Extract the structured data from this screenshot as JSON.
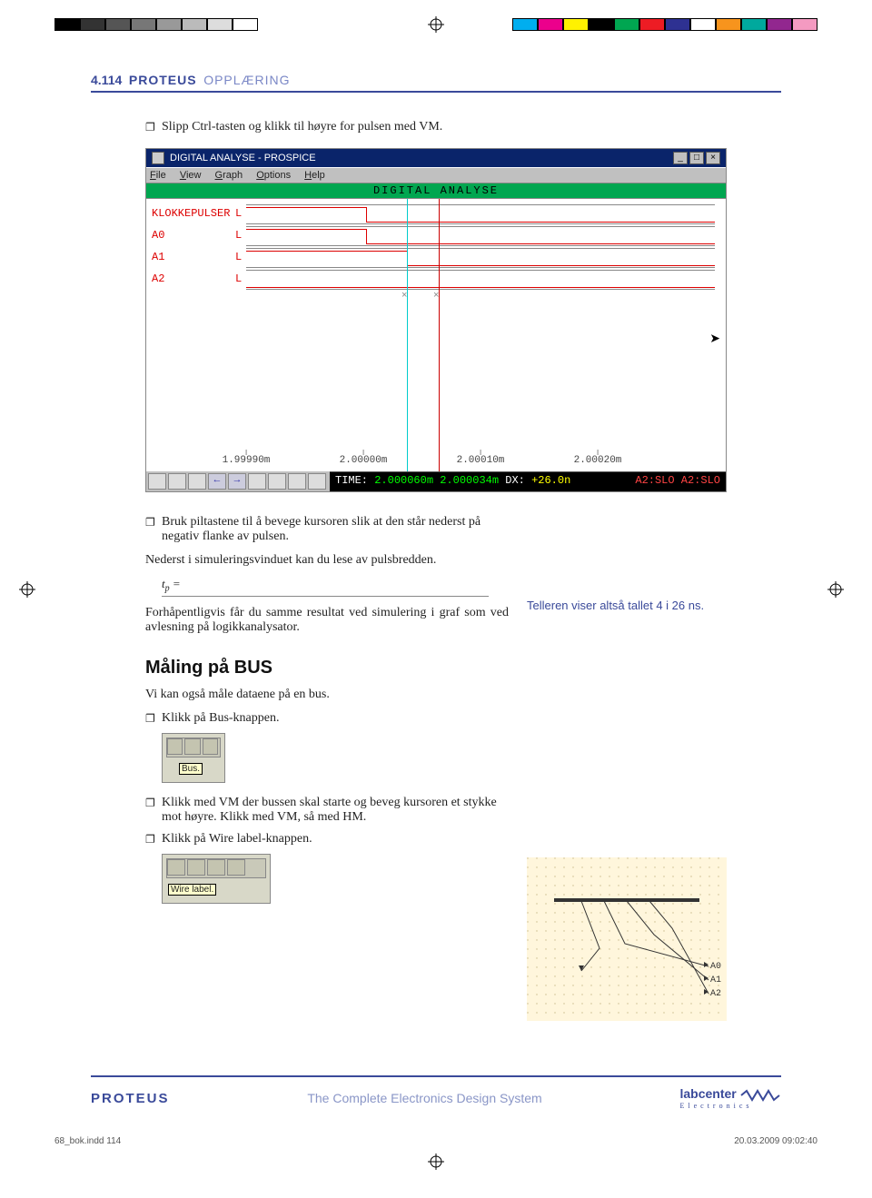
{
  "print_marks": {
    "colors_left": [
      "#000",
      "#333",
      "#555",
      "#777",
      "#999",
      "#bbb",
      "#ddd",
      "#fff"
    ],
    "colors_right": [
      "#00aeef",
      "#ec008c",
      "#fff200",
      "#000",
      "#00a651",
      "#ed1c24",
      "#2e3192",
      "#fff",
      "#f7941d",
      "#00a99d",
      "#92278f",
      "#f49ac1"
    ]
  },
  "header": {
    "page_number": "4.114",
    "brand": "PROTEUS",
    "section": "OPPLÆRING"
  },
  "body": {
    "bullet1": "Slipp Ctrl-tasten og klikk til høyre for pulsen med VM.",
    "bullet2": "Bruk piltastene til å bevege kursoren slik at den står nederst på negativ flanke av pulsen.",
    "para1": "Nederst i simuleringsvinduet kan du lese av pulsbredden.",
    "tp_label": "tₚ =",
    "para2": "Forhåpentligvis får du samme resultat ved simulering i graf som ved avlesning på logikkanalysator.",
    "teller_note": "Telleren viser altså tallet 4 i 26 ns.",
    "section_title": "Måling på BUS",
    "para3": "Vi kan også måle dataene på en bus.",
    "bullet3": "Klikk på Bus-knappen.",
    "bullet4": "Klikk med VM der bussen skal starte og beveg kursoren et stykke mot høyre. Klikk med VM, så med HM.",
    "bullet5": "Klikk på Wire label-knappen.",
    "tool_bus_label": "Bus.",
    "tool_wire_label": "Wire label."
  },
  "window": {
    "title": "DIGITAL ANALYSE - PROSPICE",
    "menu": [
      "File",
      "View",
      "Graph",
      "Options",
      "Help"
    ],
    "chart_title": "DIGITAL ANALYSE",
    "signals": [
      "KLOKKEPULSER",
      "A0",
      "A1",
      "A2"
    ],
    "level_label": "L",
    "xticks": [
      "1.99990m",
      "2.00000m",
      "2.00010m",
      "2.00020m"
    ],
    "status": {
      "time_label": "TIME:",
      "t1": "2.000060m",
      "t2": "2.000034m",
      "dx_label": "DX:",
      "dx": "+26.0n",
      "right": "A2:SLO  A2:SLO"
    },
    "win_buttons": [
      "_",
      "□",
      "×"
    ]
  },
  "schematic": {
    "labels": [
      "A0",
      "A1",
      "A2"
    ]
  },
  "footer": {
    "brand": "PROTEUS",
    "tagline": "The Complete Electronics Design System",
    "labcenter": "labcenter",
    "labcenter_sub": "E l e c t r o n i c s"
  },
  "print_footer": {
    "file": "68_bok.indd   114",
    "date": "20.03.2009   09:02:40"
  },
  "chart_data": {
    "type": "digital-timing",
    "signals": [
      {
        "name": "KLOKKEPULSER",
        "transitions_ms": [
          2.0
        ]
      },
      {
        "name": "A0",
        "transitions_ms": [
          2.0
        ]
      },
      {
        "name": "A1",
        "transitions_ms": [
          2.000034
        ]
      },
      {
        "name": "A2",
        "transitions_ms": []
      }
    ],
    "cursors_ms": [
      2.000034,
      2.00006
    ],
    "x_range_ms": [
      1.9999,
      2.0003
    ],
    "dx_ns": 26.0
  }
}
